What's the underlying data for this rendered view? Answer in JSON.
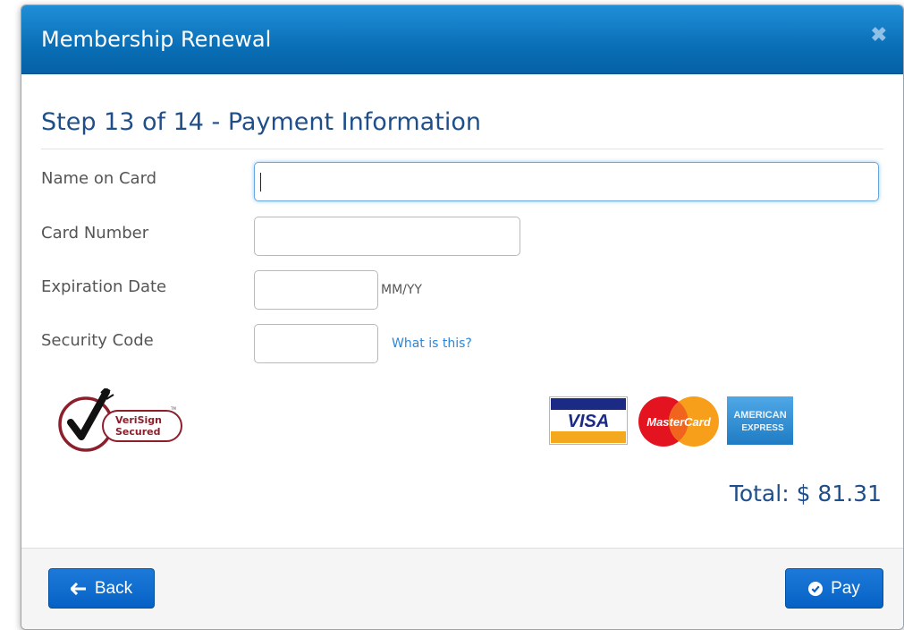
{
  "modal": {
    "title": "Membership Renewal",
    "close_icon": "close-icon"
  },
  "step": {
    "title": "Step 13 of 14 - Payment Information"
  },
  "form": {
    "name_on_card": {
      "label": "Name on Card",
      "value": ""
    },
    "card_number": {
      "label": "Card Number",
      "value": ""
    },
    "expiration_date": {
      "label": "Expiration Date",
      "value": "",
      "hint": "MM/YY"
    },
    "security_code": {
      "label": "Security Code",
      "value": "",
      "help_link": "What is this?"
    }
  },
  "badges": {
    "verisign": {
      "line1": "VeriSign",
      "line2": "Secured",
      "tm": "TM"
    },
    "cards": [
      {
        "name": "VISA",
        "icon": "visa-logo"
      },
      {
        "name": "MasterCard",
        "icon": "mastercard-logo"
      },
      {
        "name": "AMERICAN EXPRESS",
        "line1": "AMERICAN",
        "line2": "EXPRESS",
        "icon": "amex-logo"
      }
    ]
  },
  "total": {
    "text": "Total: $ 81.31"
  },
  "footer": {
    "back_label": "Back",
    "pay_label": "Pay"
  },
  "colors": {
    "header": "#0a6fb6",
    "accent_text": "#1f4f8a",
    "button": "#0561c4",
    "link": "#2a86d8"
  }
}
